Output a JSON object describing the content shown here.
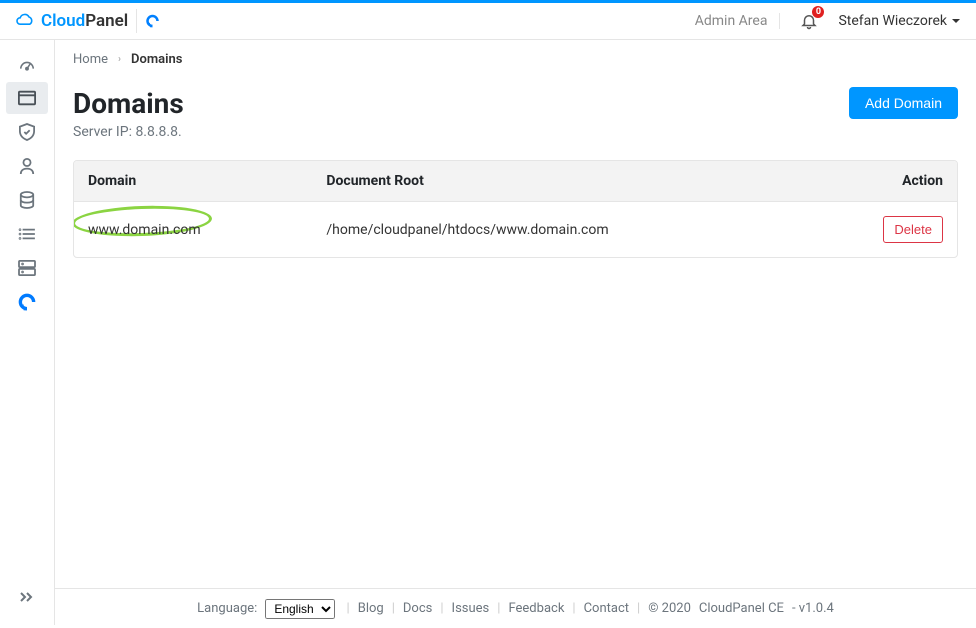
{
  "header": {
    "logo_cloud": "Cloud",
    "logo_panel": "Panel",
    "admin_area": "Admin Area",
    "notif_count": "0",
    "user_name": "Stefan Wieczorek"
  },
  "breadcrumb": {
    "home": "Home",
    "current": "Domains"
  },
  "page": {
    "title": "Domains",
    "server_ip": "Server IP: 8.8.8.8.",
    "add_btn": "Add Domain"
  },
  "table": {
    "headers": {
      "domain": "Domain",
      "docroot": "Document Root",
      "action": "Action"
    },
    "rows": [
      {
        "domain": "www.domain.com",
        "docroot": "/home/cloudpanel/htdocs/www.domain.com",
        "delete": "Delete"
      }
    ]
  },
  "footer": {
    "language_label": "Language:",
    "language_value": "English",
    "links": {
      "blog": "Blog",
      "docs": "Docs",
      "issues": "Issues",
      "feedback": "Feedback",
      "contact": "Contact"
    },
    "copyright": "© 2020",
    "product": "CloudPanel CE",
    "version": "- v1.0.4"
  }
}
